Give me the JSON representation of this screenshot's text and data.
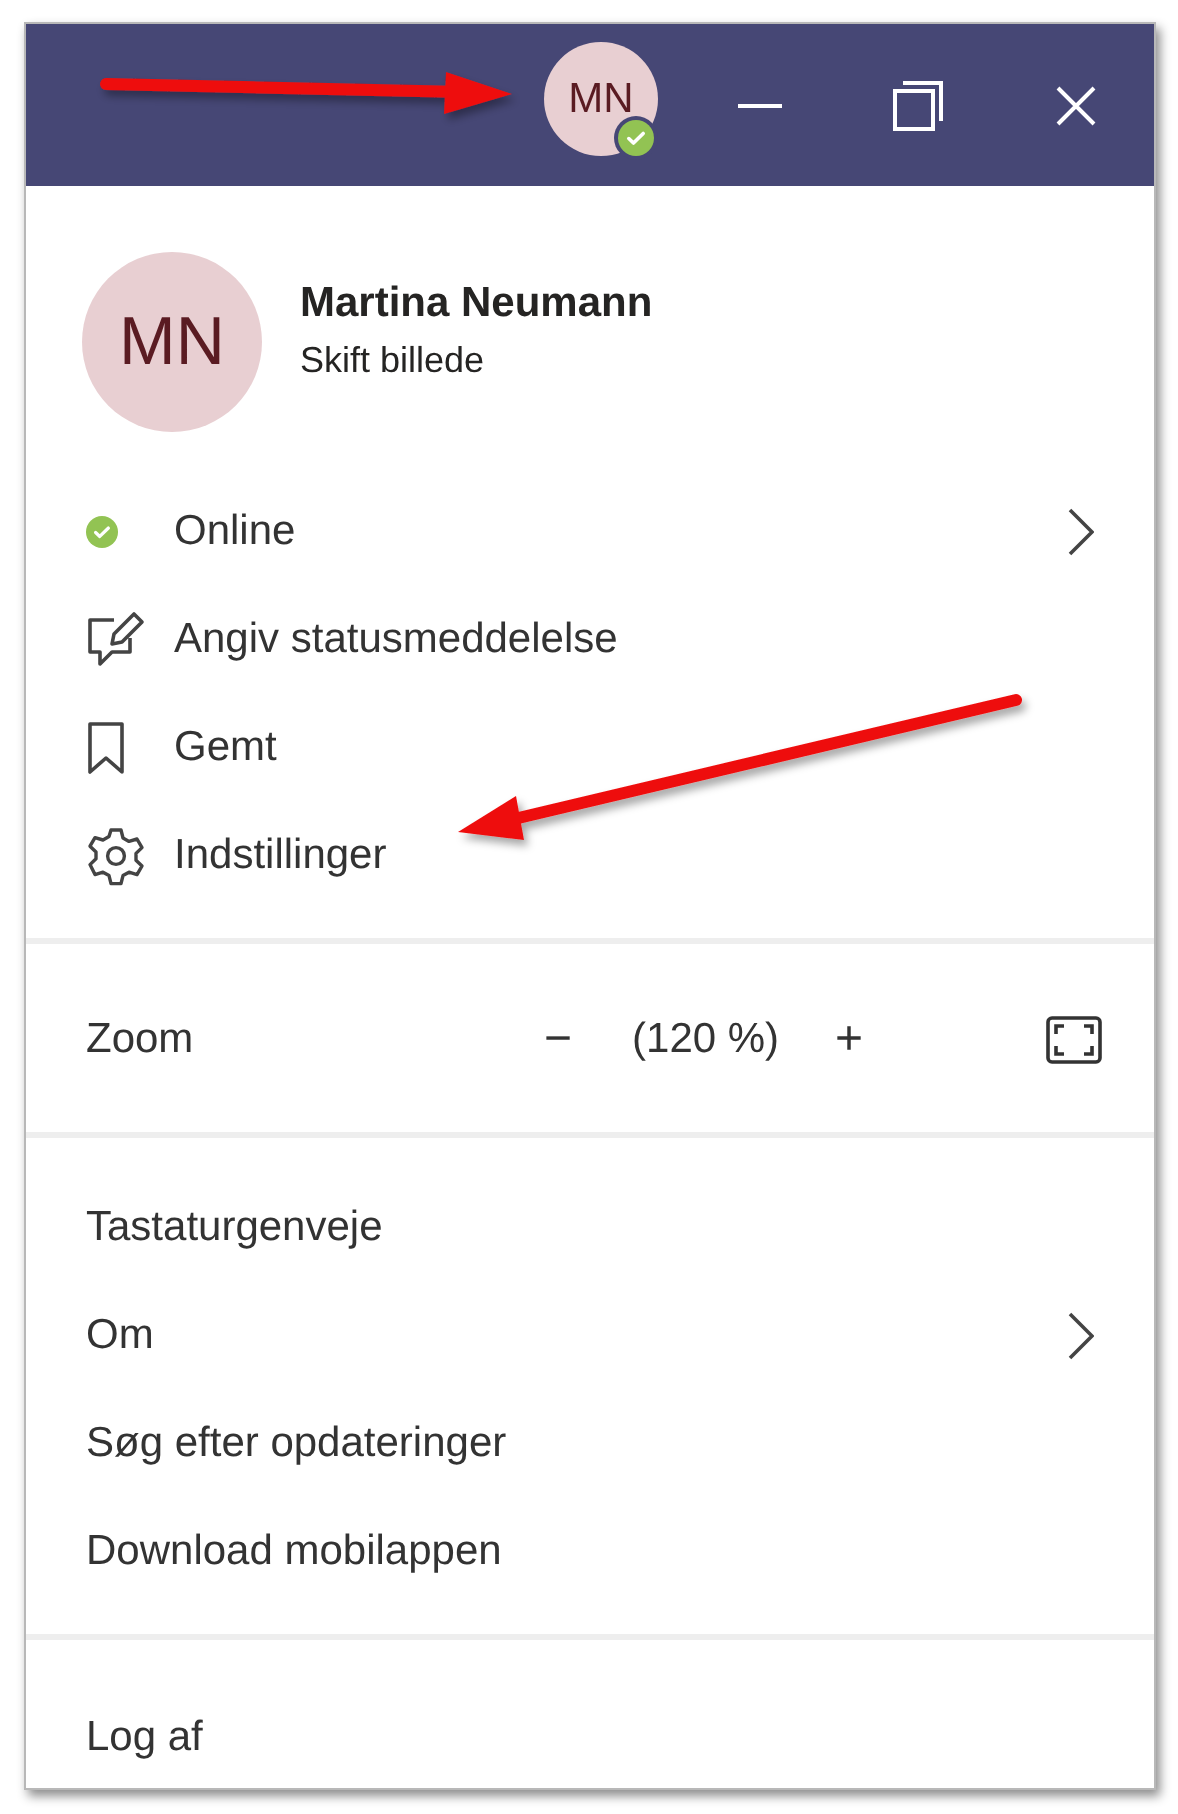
{
  "title_bar": {
    "avatar_initials": "MN",
    "online": true
  },
  "profile": {
    "initials": "MN",
    "name": "Martina Neumann",
    "change_photo": "Skift billede"
  },
  "status_menu": [
    {
      "kind": "status",
      "label": "Online",
      "submenu": true
    },
    {
      "kind": "edit",
      "label": "Angiv statusmeddelelse",
      "submenu": false
    },
    {
      "kind": "saved",
      "label": "Gemt",
      "submenu": false
    },
    {
      "kind": "settings",
      "label": "Indstillinger",
      "submenu": false
    }
  ],
  "zoom": {
    "label": "Zoom",
    "decrease": "−",
    "value": "(120 %)",
    "increase": "+"
  },
  "app_menu": [
    {
      "label": "Tastaturgenveje",
      "submenu": false
    },
    {
      "label": "Om",
      "submenu": true
    },
    {
      "label": "Søg efter opdateringer",
      "submenu": false
    },
    {
      "label": "Download mobilappen",
      "submenu": false
    }
  ],
  "sign_out": "Log af"
}
